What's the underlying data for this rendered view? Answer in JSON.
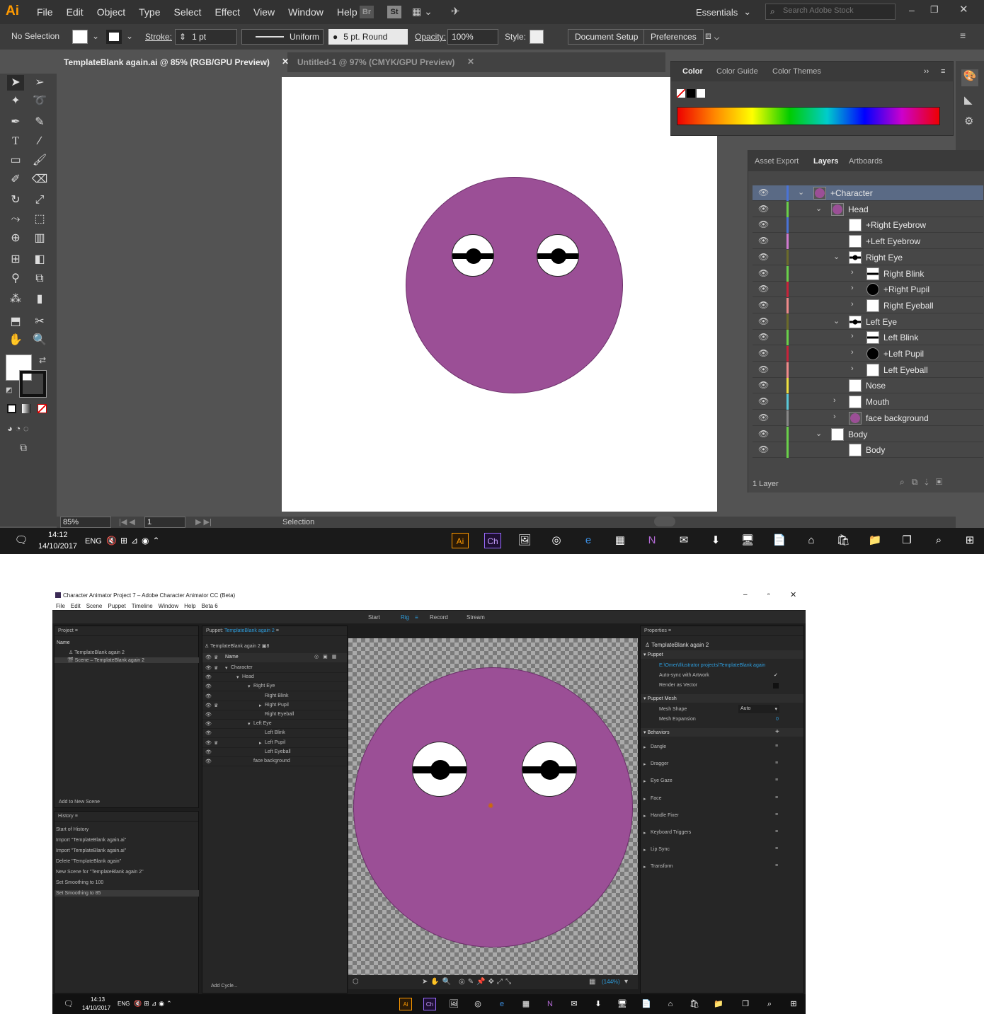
{
  "ai": {
    "logo": "Ai",
    "menu": [
      "File",
      "Edit",
      "Object",
      "Type",
      "Select",
      "Effect",
      "View",
      "Window",
      "Help"
    ],
    "bridge": "Br",
    "stock": "St",
    "workspace": "Essentials",
    "search_placeholder": "Search Adobe Stock",
    "control": {
      "selection": "No Selection",
      "stroke_label": "Stroke:",
      "stroke_weight": "1 pt",
      "profile": "Uniform",
      "brush": "5 pt. Round",
      "opacity_label": "Opacity:",
      "opacity": "100%",
      "style_label": "Style:",
      "doc_setup": "Document Setup",
      "preferences": "Preferences"
    },
    "tabs": [
      "TemplateBlank again.ai @ 85% (RGB/GPU Preview)",
      "Untitled-1 @ 97% (CMYK/GPU Preview)"
    ],
    "color_panel": {
      "tabs": [
        "Color",
        "Color Guide",
        "Color Themes"
      ]
    },
    "layers_panel": {
      "tabs": [
        "Asset Export",
        "Layers",
        "Artboards"
      ],
      "rows": [
        {
          "name": "+Character",
          "color": "#4a73d6",
          "thumb": "#9b4f96",
          "expanded": true
        },
        {
          "name": "Head",
          "color": "#6ad04a",
          "thumb": "#9b4f96",
          "expanded": true
        },
        {
          "name": "+Right Eyebrow",
          "color": "#4a73d6",
          "thumb": "#ffffff"
        },
        {
          "name": "+Left Eyebrow",
          "color": "#d07ad0",
          "thumb": "#ffffff"
        },
        {
          "name": "Right Eye",
          "color": "#6b6b2a",
          "thumb": "eye",
          "expanded": true
        },
        {
          "name": "Right Blink",
          "color": "#6ad04a",
          "thumb": "blink"
        },
        {
          "name": "+Right Pupil",
          "color": "#c8233a",
          "thumb": "pupil"
        },
        {
          "name": "Right Eyeball",
          "color": "#f08a8a",
          "thumb": "#ffffff"
        },
        {
          "name": "Left Eye",
          "color": "#6b6b2a",
          "thumb": "eye",
          "expanded": true
        },
        {
          "name": "Left Blink",
          "color": "#6ad04a",
          "thumb": "blink"
        },
        {
          "name": "+Left Pupil",
          "color": "#c8233a",
          "thumb": "pupil"
        },
        {
          "name": "Left Eyeball",
          "color": "#f08a8a",
          "thumb": "#ffffff"
        },
        {
          "name": "Nose",
          "color": "#f0e040",
          "thumb": "#ffffff"
        },
        {
          "name": "Mouth",
          "color": "#5ac8d8",
          "thumb": "#ffffff"
        },
        {
          "name": "face background",
          "color": "#888888",
          "thumb": "#9b4f96"
        },
        {
          "name": "Body",
          "color": "#6ad04a",
          "thumb": "#ffffff",
          "expanded": true
        },
        {
          "name": "Body",
          "color": "#6ad04a",
          "thumb": "#ffffff"
        }
      ],
      "footer": "1 Layer"
    },
    "status": {
      "zoom": "85%",
      "page": "1",
      "tool": "Selection"
    }
  },
  "taskbar1": {
    "time": "14:12",
    "date": "14/10/2017",
    "lang": "ENG"
  },
  "ch": {
    "title": "Character Animator Project 7 – Adobe Character Animator CC (Beta)",
    "menu": [
      "File",
      "Edit",
      "Scene",
      "Puppet",
      "Timeline",
      "Window",
      "Help",
      "Beta 6"
    ],
    "modes": [
      "Start",
      "Rig",
      "Record",
      "Stream"
    ],
    "project": {
      "title": "Project",
      "col": "Name",
      "items": [
        "TemplateBlank again 2",
        "Scene – TemplateBlank again 2"
      ],
      "add_scene": "Add to New Scene"
    },
    "history": {
      "title": "History",
      "items": [
        "Start of History",
        "Import \"TemplateBlank again.ai\"",
        "Import \"TemplateBlank again.ai\"",
        "Delete \"TemplateBlank again\"",
        "New Scene for \"TemplateBlank again 2\"",
        "Set Smoothing to 100",
        "Set Smoothing to 85"
      ]
    },
    "puppet": {
      "title_prefix": "Puppet:",
      "title_name": "TemplateBlank again 2",
      "sub": "TemplateBlank again 2",
      "count": "8",
      "col": "Name",
      "rows": [
        "Character",
        "Head",
        "Right Eye",
        "Right Blink",
        "Right Pupil",
        "Right Eyeball",
        "Left Eye",
        "Left Blink",
        "Left Pupil",
        "Left Eyeball",
        "face background"
      ],
      "add_cycle": "Add Cycle..."
    },
    "zoom": "(144%)",
    "properties": {
      "title": "Properties",
      "puppet_name": "TemplateBlank again 2",
      "section_puppet": "Puppet",
      "path": "E:\\Omer\\Illustrator projects\\TemplateBlank again",
      "autosync": "Auto-sync with Artwork",
      "vector": "Render as Vector",
      "section_mesh": "Puppet Mesh",
      "mesh_shape": "Mesh Shape",
      "mesh_shape_val": "Auto",
      "mesh_exp": "Mesh Expansion",
      "mesh_exp_val": "0",
      "section_behaviors": "Behaviors",
      "behaviors": [
        "Dangle",
        "Dragger",
        "Eye Gaze",
        "Face",
        "Handle Fixer",
        "Keyboard Triggers",
        "Lip Sync",
        "Transform"
      ]
    }
  },
  "taskbar2": {
    "time": "14:13",
    "date": "14/10/2017",
    "lang": "ENG"
  }
}
